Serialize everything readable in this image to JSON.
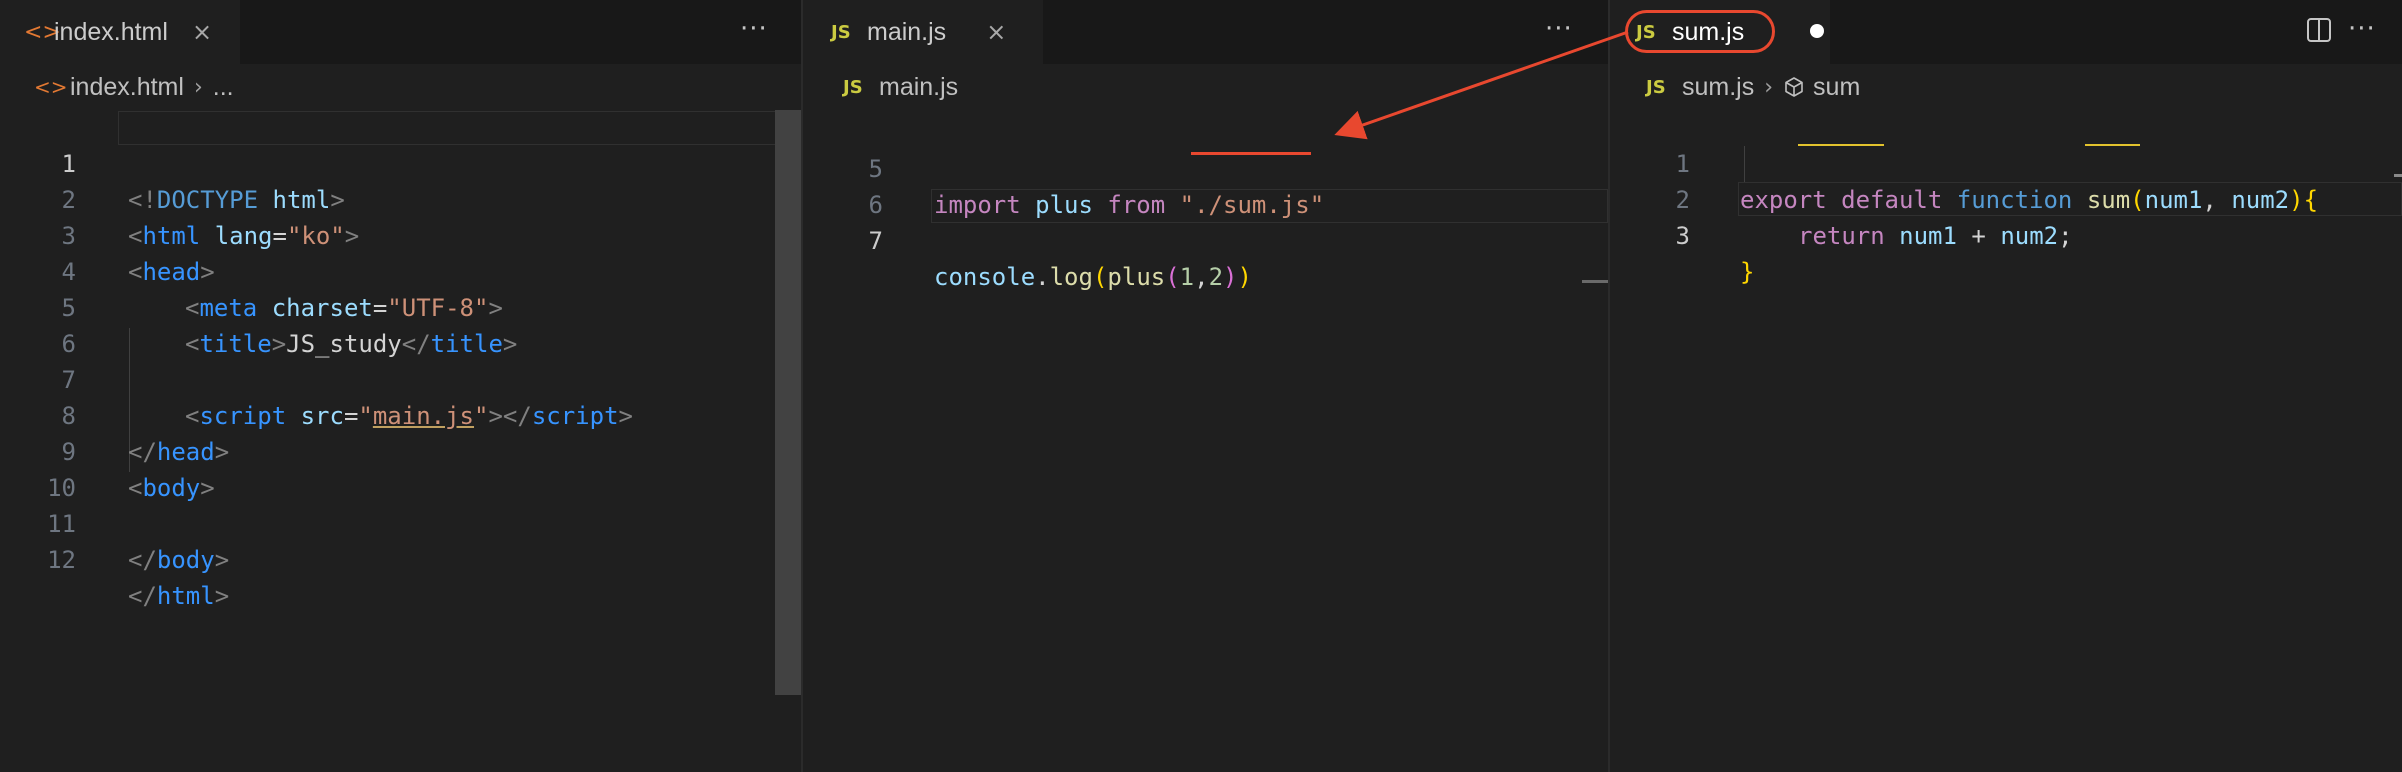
{
  "panes": {
    "index": {
      "tab": {
        "icon": "html-file-icon",
        "label": "index.html",
        "close": "×"
      },
      "breadcrumb": {
        "file": "index.html",
        "more": "..."
      },
      "lines": [
        {
          "n": "1"
        },
        {
          "n": "2"
        },
        {
          "n": "3"
        },
        {
          "n": "4"
        },
        {
          "n": "5"
        },
        {
          "n": "6"
        },
        {
          "n": "7"
        },
        {
          "n": "8"
        },
        {
          "n": "9"
        },
        {
          "n": "10"
        },
        {
          "n": "11"
        },
        {
          "n": "12"
        }
      ],
      "tokens": {
        "l1": [
          "<!",
          "DOCTYPE",
          " html",
          ">"
        ],
        "l2": [
          "<",
          "html",
          " lang",
          "=",
          "\"ko\"",
          ">"
        ],
        "l3": [
          "<",
          "head",
          ">"
        ],
        "l4": [
          "<",
          "meta",
          " charset",
          "=",
          "\"UTF-8\"",
          ">"
        ],
        "l5": [
          "<",
          "title",
          ">",
          "JS_study",
          "</",
          "title",
          ">"
        ],
        "l7": [
          "<",
          "script",
          " src",
          "=",
          "\"",
          "main.js",
          "\"",
          "></",
          "script",
          ">"
        ],
        "l8": [
          "</",
          "head",
          ">"
        ],
        "l9": [
          "<",
          "body",
          ">"
        ],
        "l11": [
          "</",
          "body",
          ">"
        ],
        "l12": [
          "</",
          "html",
          ">"
        ]
      }
    },
    "main": {
      "tab": {
        "icon": "js-file-icon",
        "icon_text": "JS",
        "label": "main.js",
        "close": "×"
      },
      "breadcrumb": {
        "icon_text": "JS",
        "file": "main.js"
      },
      "lines": [
        {
          "n": "5"
        },
        {
          "n": "6"
        },
        {
          "n": "7"
        }
      ],
      "tokens": {
        "l5": [
          "import",
          " plus ",
          "from",
          " ",
          "\"./sum.js\""
        ],
        "l7": [
          "console",
          ".",
          "log",
          "(",
          "plus",
          "(",
          "1",
          ",",
          "2",
          ")",
          ")"
        ]
      }
    },
    "sum": {
      "tab": {
        "icon": "js-file-icon",
        "icon_text": "JS",
        "label": "sum.js"
      },
      "breadcrumb": {
        "icon_text": "JS",
        "file": "sum.js",
        "symbol": "sum"
      },
      "lines": [
        {
          "n": "1"
        },
        {
          "n": "2"
        },
        {
          "n": "3"
        }
      ],
      "tokens": {
        "l1": [
          "export",
          " ",
          "default",
          " ",
          "function",
          " ",
          "sum",
          "(",
          "num1",
          ", ",
          "num2",
          ")",
          "{"
        ],
        "l2": [
          "return",
          " ",
          "num1",
          " + ",
          "num2",
          ";"
        ],
        "l3": [
          "}"
        ]
      }
    }
  },
  "more_actions": "···",
  "colors": {
    "annotation": "#e8482f",
    "background": "#1f1f1f"
  }
}
